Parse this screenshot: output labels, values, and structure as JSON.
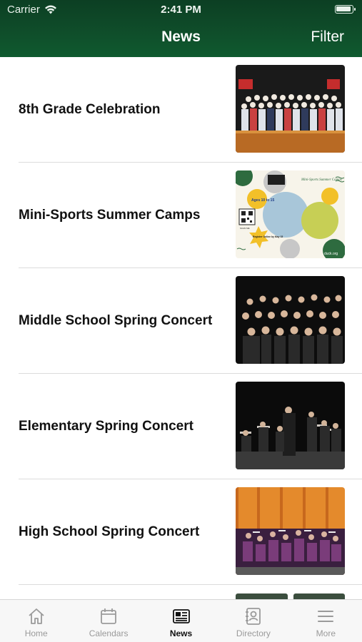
{
  "status_bar": {
    "carrier": "Carrier",
    "time": "2:41 PM",
    "battery_level": 0.95
  },
  "nav": {
    "title": "News",
    "filter_label": "Filter"
  },
  "news_items": [
    {
      "title": "8th Grade Celebration",
      "image": "stage-group-photo"
    },
    {
      "title": "Mini-Sports Summer Camps",
      "image": "summer-camps-flyer"
    },
    {
      "title": "Middle School Spring Concert",
      "image": "choir-photo"
    },
    {
      "title": "Elementary Spring Concert",
      "image": "band-photo"
    },
    {
      "title": "High School Spring Concert",
      "image": "orchestra-photo"
    }
  ],
  "flyer": {
    "ages": "Ages 10 to 15",
    "camps_title": "Mini-Sports Summer Camps",
    "url": "duck.org",
    "register": "Register Online by May 15",
    "qr_label": "SCAN ME"
  },
  "tabs": [
    {
      "label": "Home",
      "icon": "home-icon",
      "active": false
    },
    {
      "label": "Calendars",
      "icon": "calendar-icon",
      "active": false
    },
    {
      "label": "News",
      "icon": "news-icon",
      "active": true
    },
    {
      "label": "Directory",
      "icon": "directory-icon",
      "active": false
    },
    {
      "label": "More",
      "icon": "menu-icon",
      "active": false
    }
  ],
  "colors": {
    "header_green": "#0f4d2a",
    "tab_active": "#111111",
    "tab_inactive": "#9a9a9a"
  }
}
